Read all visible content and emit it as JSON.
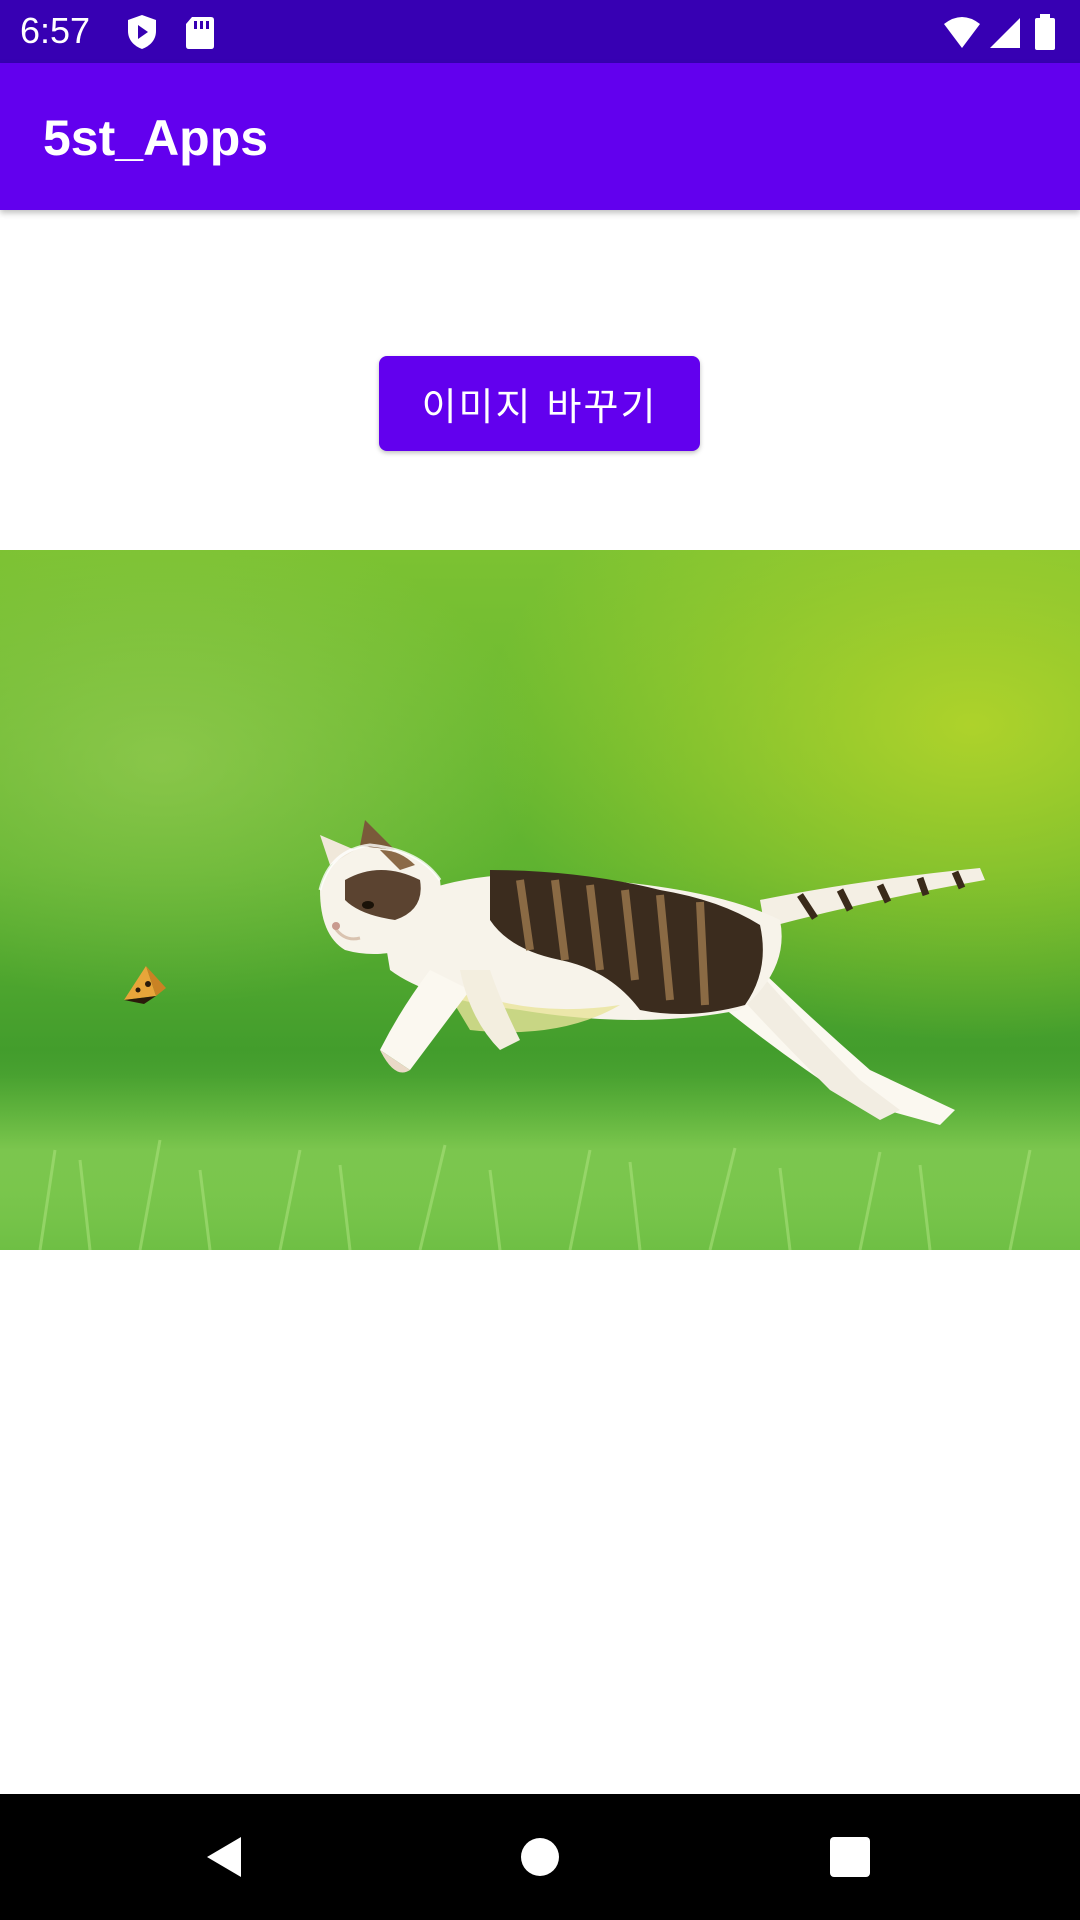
{
  "status_bar": {
    "time": "6:57",
    "left_icons": [
      "shield-play-icon",
      "sd-card-icon"
    ],
    "right_icons": [
      "wifi-icon",
      "signal-icon",
      "battery-icon"
    ],
    "color": "#3700B3"
  },
  "app_bar": {
    "title": "5st_Apps",
    "color": "#6200EE"
  },
  "main": {
    "change_button_label": "이미지 바꾸기",
    "image_subject": "kitten-chasing-butterfly-photo"
  },
  "nav_bar": {
    "buttons": [
      "back-icon",
      "home-icon",
      "recents-icon"
    ]
  }
}
